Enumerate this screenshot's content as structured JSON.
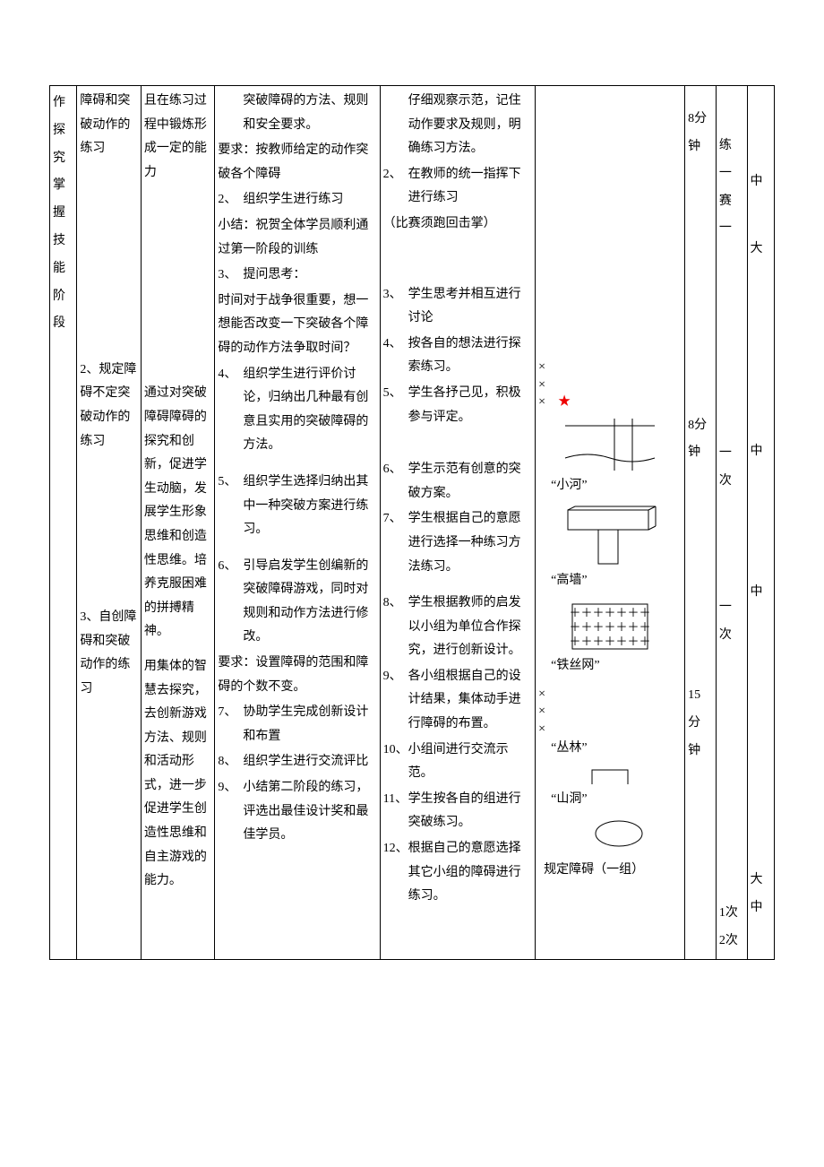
{
  "stage": "作探究掌握技能阶段",
  "topics": [
    "障碍和突破动作的练习",
    "2、规定障碍不定突破动作的练习",
    "3、自创障碍和突破动作的练习"
  ],
  "goals": [
    "且在练习过程中锻炼形成一定的能力",
    "通过对突破障碍障碍的探究和创新，促进学生动脑，发展学生形象思维和创造性思维。培养克服困难的拼搏精神。",
    "用集体的智慧去探究，去创新游戏方法、规则和活动形式，进一步促进学生创造性思维和自主游戏的能力。"
  ],
  "teacher": {
    "t0": "突破障碍的方法、规则和安全要求。",
    "t0b": "要求：按教师给定的动作突破各个障碍",
    "i2": "组织学生进行练习",
    "sum1a": "小结：祝贺全体学员顺利通过第一阶段的训练",
    "i3": "提问思考：",
    "q1": "时间对于战争很重要，想一想能否改变一下突破各个障碍的动作方法争取时间？",
    "i4": "组织学生进行评价讨论，归纳出几种最有创意且实用的突破障碍的方法。",
    "i5": "组织学生选择归纳出其中一种突破方案进行练习。",
    "i6": "引导启发学生创编新的突破障碍游戏，同时对规则和动作方法进行修改。",
    "req2": "要求：设置障碍的范围和障碍的个数不变。",
    "i7": "协助学生完成创新设计和布置",
    "i8": "组织学生进行交流评比",
    "i9": "小结第二阶段的练习，评选出最佳设计奖和最佳学员。"
  },
  "student": {
    "s1": "仔细观察示范，记住动作要求及规则，明确练习方法。",
    "s2": "在教师的统一指挥下进行练习",
    "s2b": "（比赛须跑回击掌）",
    "s3": "学生思考并相互进行讨论",
    "s4": "按各自的想法进行探索练习。",
    "s5": "学生各抒己见，积极参与评定。",
    "s6": "学生示范有创意的突破方案。",
    "s7": "学生根据自己的意愿进行选择一种练习方法练习。",
    "s8": "学生根据教师的启发以小组为单位合作探究，进行创新设计。",
    "s9": "各小组根据自己的设计结果，集体动手进行障碍的布置。",
    "s10": "小组间进行交流示范。",
    "s11": "学生按各自的组进行突破练习。",
    "s12": "根据自己的意愿选择其它小组的障碍进行练习。"
  },
  "diagram": {
    "river": "“小河”",
    "wall": "“高墙”",
    "wire": "“铁丝网”",
    "bush": "“丛林”",
    "cave": "“山洞”",
    "footer": "规定障碍（一组）"
  },
  "time": {
    "t1": "8分钟",
    "t2": "8分钟",
    "t3": "15分钟"
  },
  "count": {
    "c1": "练一赛一",
    "c2": "一次",
    "c3": "一次",
    "c4a": "1次",
    "c4b": "2次"
  },
  "level": {
    "l1a": "中",
    "l1b": "大",
    "l2": "中",
    "l3": "中",
    "l4a": "大",
    "l4b": "中"
  },
  "nums": {
    "n2": "2、",
    "n3": "3、",
    "n4": "4、",
    "n5": "5、",
    "n6": "6、",
    "n7": "7、",
    "n8": "8、",
    "n9": "9、",
    "n10": "10、",
    "n11": "11、",
    "n12": "12、"
  }
}
